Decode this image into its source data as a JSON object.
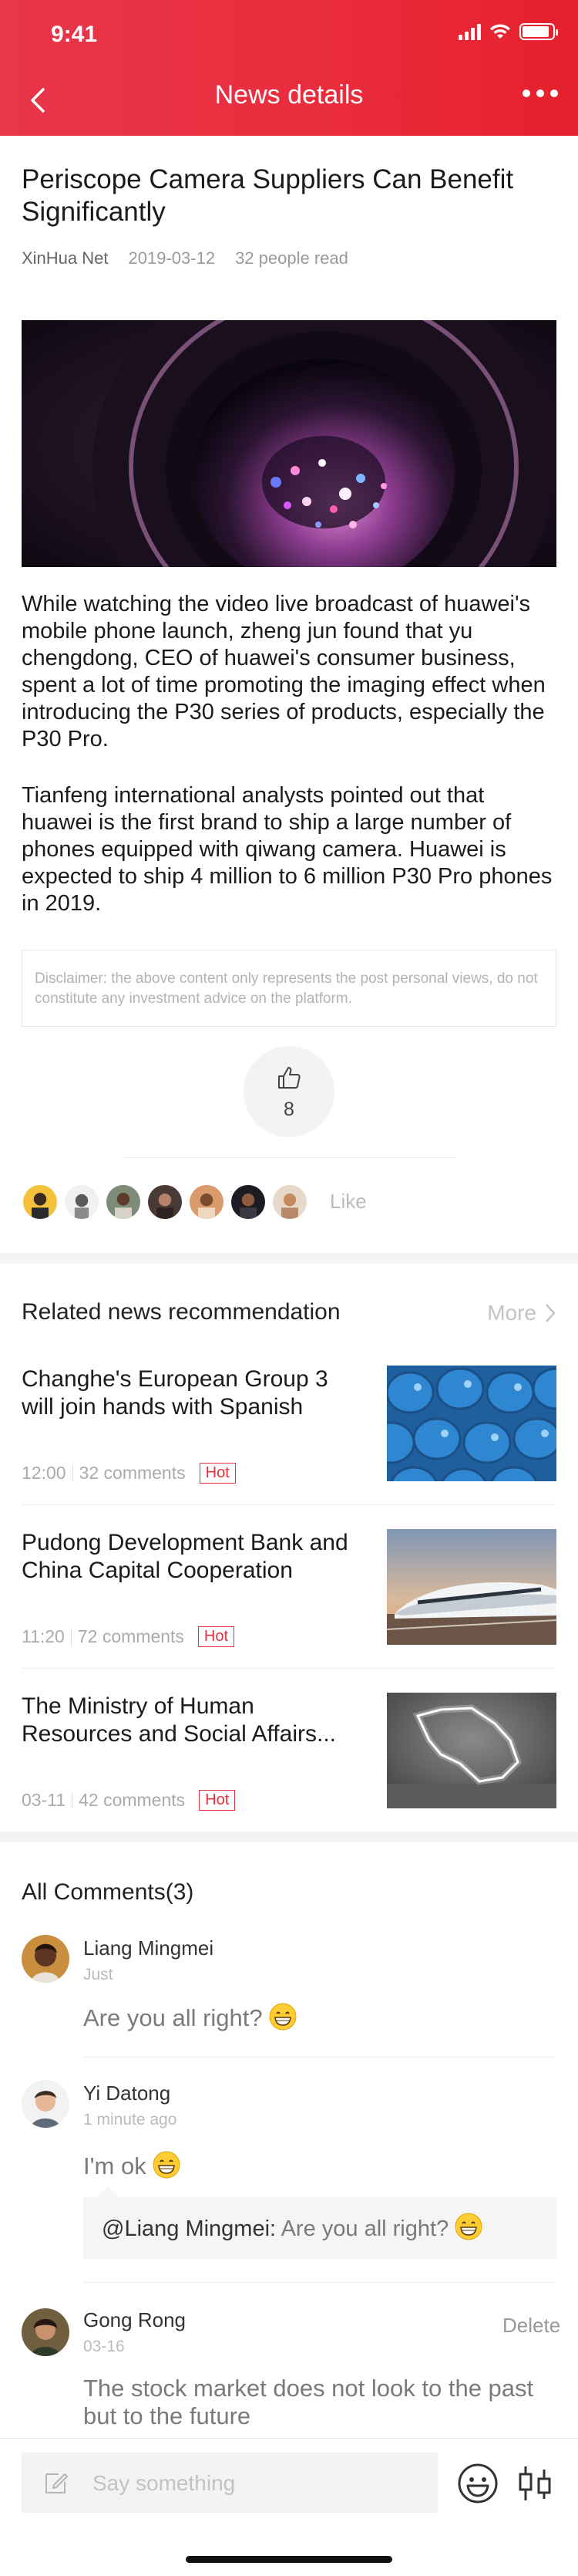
{
  "status_bar": {
    "time": "9:41"
  },
  "nav": {
    "title": "News details",
    "back_icon": "chevron-left-icon",
    "more_icon": "more-dots-icon"
  },
  "article": {
    "title": "Periscope Camera Suppliers Can Benefit Significantly",
    "source": "XinHua Net",
    "date": "2019-03-12",
    "reads": "32 people read",
    "paragraphs": [
      "While watching the video live broadcast of huawei's mobile phone launch, zheng jun found that yu chengdong, CEO of huawei's consumer business, spent a lot of time promoting the imaging effect when introducing the P30 series of products, especially the P30 Pro.",
      "Tianfeng international analysts pointed out that huawei is the first brand to ship a large number of phones equipped with qiwang camera. Huawei is expected to ship 4 million to 6 million P30 Pro phones in 2019."
    ],
    "disclaimer": "Disclaimer: the above content only represents the post personal views, do not constitute any investment advice on the platform.",
    "like_count": "8",
    "likes_label": "Like"
  },
  "related": {
    "title": "Related news recommendation",
    "more_label": "More",
    "items": [
      {
        "title": "Changhe's European Group 3 will join hands with Spanish",
        "time": "12:00",
        "comments": "32 comments",
        "badge": "Hot"
      },
      {
        "title": "Pudong Development Bank and China Capital Cooperation",
        "time": "11:20",
        "comments": "72 comments",
        "badge": "Hot"
      },
      {
        "title": "The Ministry of Human Resources and Social Affairs...",
        "time": "03-11",
        "comments": "42 comments",
        "badge": "Hot"
      }
    ]
  },
  "comments": {
    "title": "All Comments(3)",
    "items": [
      {
        "name": "Liang Mingmei",
        "time": "Just",
        "text": "Are you all right?"
      },
      {
        "name": "Yi Datong",
        "time": "1 minute ago",
        "text": "I'm ok",
        "reply_to": "@Liang Mingmei:",
        "reply_text": "Are you all right?"
      },
      {
        "name": "Gong Rong",
        "time": "03-16",
        "text": "The stock market does not look to the past but to the future",
        "action": "Delete"
      }
    ]
  },
  "composer": {
    "placeholder": "Say something",
    "emoji_icon": "emoji-smile-icon",
    "stock_icon": "candlestick-icon"
  },
  "colors": {
    "accent": "#E6303D",
    "header_start": "#E8364A",
    "header_end": "#E6202D",
    "muted": "#9A9A9A"
  }
}
